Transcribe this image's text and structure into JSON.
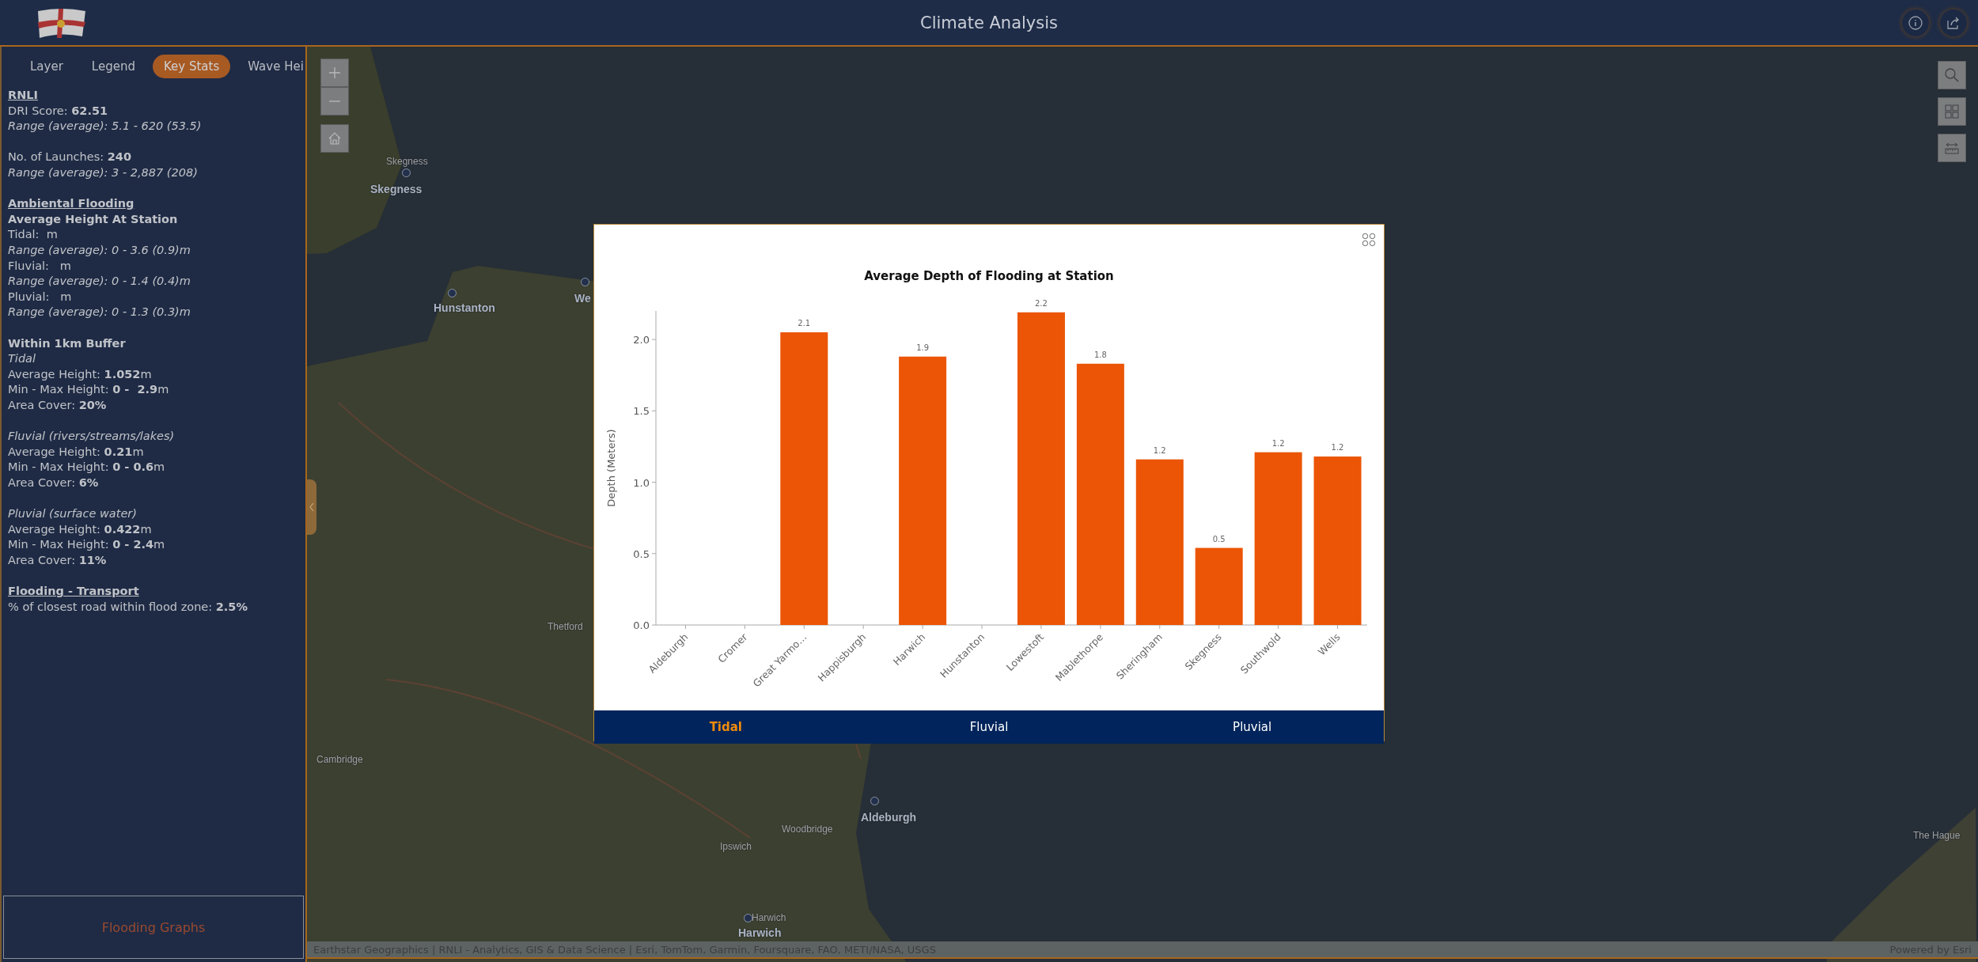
{
  "header": {
    "title": "Climate Analysis"
  },
  "sidebar": {
    "tabs": [
      {
        "label": "Layer",
        "selected": false
      },
      {
        "label": "Legend",
        "selected": false
      },
      {
        "label": "Key Stats",
        "selected": true
      },
      {
        "label": "Wave Hei",
        "selected": false
      }
    ],
    "sections": [
      {
        "lines": [
          {
            "kind": "heading",
            "text": "RNLI"
          },
          {
            "kind": "plain",
            "text": "DRI Score: **62.51**"
          },
          {
            "kind": "italic",
            "text": "Range (average): 5.1 - 620 (53.5)"
          }
        ]
      },
      {
        "lines": [
          {
            "kind": "plain",
            "text": "No. of Launches: **240**"
          },
          {
            "kind": "italic",
            "text": "Range (average): 3 - 2,887 (208)"
          }
        ]
      },
      {
        "lines": [
          {
            "kind": "heading",
            "text": "Ambiental Flooding"
          },
          {
            "kind": "bold",
            "text": "Average Height At Station"
          },
          {
            "kind": "plain",
            "text": "Tidal:  m"
          },
          {
            "kind": "italic",
            "text": "Range (average): 0 - 3.6 (0.9)m"
          },
          {
            "kind": "plain",
            "text": "Fluvial:   m"
          },
          {
            "kind": "italic",
            "text": "Range (average): 0 - 1.4 (0.4)m"
          },
          {
            "kind": "plain",
            "text": "Pluvial:   m"
          },
          {
            "kind": "italic",
            "text": "Range (average): 0 - 1.3 (0.3)m"
          }
        ]
      },
      {
        "lines": [
          {
            "kind": "bold",
            "text": "Within 1km Buffer"
          },
          {
            "kind": "italic",
            "text": "Tidal"
          },
          {
            "kind": "plain",
            "text": "Average Height: **1.052**m"
          },
          {
            "kind": "plain",
            "text": "Min - Max Height: **0 -  2.9**m"
          },
          {
            "kind": "plain",
            "text": "Area Cover: **20%**"
          }
        ]
      },
      {
        "lines": [
          {
            "kind": "italic",
            "text": "Fluvial (rivers/streams/lakes)"
          },
          {
            "kind": "plain",
            "text": "Average Height: **0.21**m"
          },
          {
            "kind": "plain",
            "text": "Min - Max Height: **0 - 0.6**m"
          },
          {
            "kind": "plain",
            "text": "Area Cover: **6%**"
          }
        ]
      },
      {
        "lines": [
          {
            "kind": "italic",
            "text": "Pluvial (surface water)"
          },
          {
            "kind": "plain",
            "text": "Average Height: **0.422**m"
          },
          {
            "kind": "plain",
            "text": "Min - Max Height: **0 - 2.4**m"
          },
          {
            "kind": "plain",
            "text": "Area Cover: **11%**"
          }
        ]
      },
      {
        "lines": [
          {
            "kind": "heading",
            "text": "Flooding - Transport"
          },
          {
            "kind": "plain",
            "text": "% of closest road within flood zone: **2.5%**"
          }
        ]
      }
    ],
    "footer_button": "Flooding Graphs"
  },
  "map": {
    "place_labels": [
      {
        "text": "Skegness",
        "kind": "town"
      },
      {
        "text": "Skegness",
        "kind": "station"
      },
      {
        "text": "Hunstanton",
        "kind": "station"
      },
      {
        "text": "We",
        "kind": "station"
      },
      {
        "text": "Thetford",
        "kind": "town"
      },
      {
        "text": "Cambridge",
        "kind": "town"
      },
      {
        "text": "Woodbridge",
        "kind": "town"
      },
      {
        "text": "Ipswich",
        "kind": "town"
      },
      {
        "text": "Aldeburgh",
        "kind": "station"
      },
      {
        "text": "Harwich",
        "kind": "town"
      },
      {
        "text": "Harwich",
        "kind": "station"
      },
      {
        "text": "The Hague",
        "kind": "town"
      }
    ],
    "attribution": "Earthstar Geographics | RNLI - Analytics, GIS & Data Science | Esri, TomTom, Garmin, Foursquare, FAO, METI/NASA, USGS",
    "powered_by": "Powered by Esri"
  },
  "modal": {
    "chart_data": {
      "type": "bar",
      "title": "Average Depth of Flooding at Station",
      "ylabel": "Depth (Meters)",
      "categories": [
        "Aldeburgh",
        "Cromer",
        "Great Yarmo…",
        "Happisburgh",
        "Harwich",
        "Hunstanton",
        "Lowestoft",
        "Mablethorpe",
        "Sheringham",
        "Skegness",
        "Southwold",
        "Wells"
      ],
      "values": [
        null,
        null,
        2.05,
        null,
        1.88,
        null,
        2.19,
        1.83,
        1.16,
        0.54,
        1.21,
        1.18
      ],
      "value_labels": [
        null,
        null,
        "2.1",
        null,
        "1.9",
        null,
        "2.2",
        "1.8",
        "1.2",
        "0.5",
        "1.2",
        "1.2"
      ],
      "ylim": [
        0,
        2.2
      ],
      "yticks": [
        {
          "value": 0,
          "label": "0.0"
        },
        {
          "value": 0.5,
          "label": "0.5"
        },
        {
          "value": 1,
          "label": "1.0"
        },
        {
          "value": 1.5,
          "label": "1.5"
        },
        {
          "value": 2,
          "label": "2.0"
        }
      ]
    },
    "tabs": [
      {
        "label": "Tidal",
        "selected": true
      },
      {
        "label": "Fluvial",
        "selected": false
      },
      {
        "label": "Pluvial",
        "selected": false
      }
    ]
  }
}
